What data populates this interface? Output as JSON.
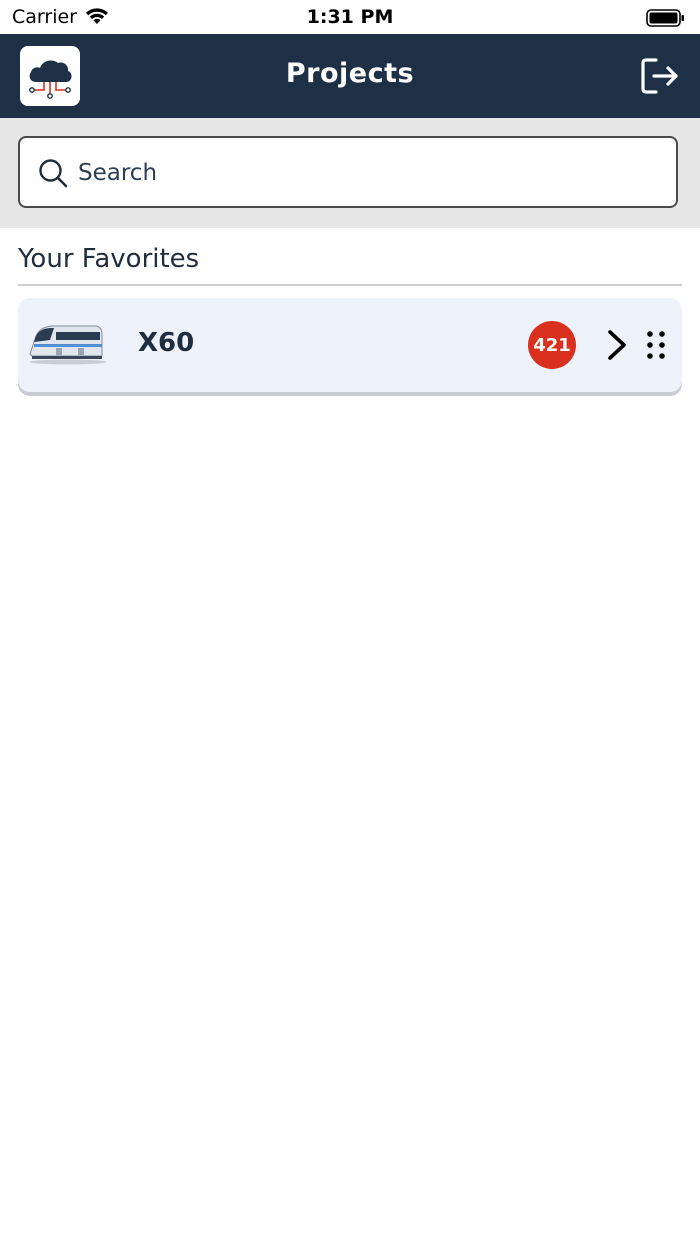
{
  "status_bar": {
    "carrier": "Carrier",
    "time": "1:31 PM"
  },
  "header": {
    "title": "Projects",
    "logo_icon": "cloud-network-icon",
    "logout_icon": "logout-icon"
  },
  "search": {
    "placeholder": "Search",
    "value": ""
  },
  "favorites": {
    "title": "Your Favorites",
    "items": [
      {
        "name": "X60",
        "count": "421",
        "thumbnail": "train-image"
      }
    ]
  },
  "colors": {
    "nav_background": "#1e3045",
    "badge_red": "#d9301f",
    "card_background": "#eef2fa",
    "search_strip": "#e6e6e6"
  }
}
